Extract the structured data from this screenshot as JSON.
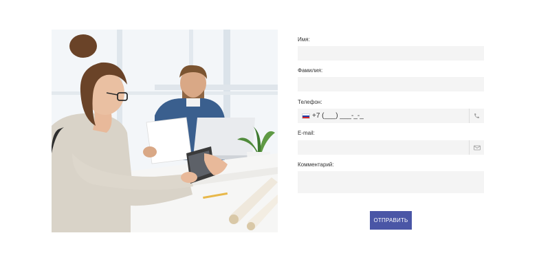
{
  "form": {
    "name_label": "Имя:",
    "name_value": "",
    "surname_label": "Фамилия:",
    "surname_value": "",
    "phone_label": "Телефон:",
    "phone_value": "+7 (___) ___-_-_",
    "email_label": "E-mail:",
    "email_value": "",
    "comment_label": "Комментарий:",
    "comment_value": "",
    "submit_label": "ОТПРАВИТЬ"
  },
  "icons": {
    "phone_suffix": "phone-icon",
    "email_suffix": "envelope-icon",
    "country_flag": "russia-flag-icon"
  },
  "colors": {
    "submit_button": "#4a56a6",
    "field_background": "#f4f4f4"
  }
}
